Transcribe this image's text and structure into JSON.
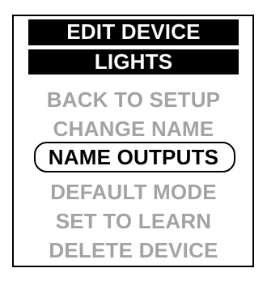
{
  "screen": {
    "title": "EDIT DEVICE",
    "device_name": "LIGHTS",
    "selected_index": 2,
    "menu_items": [
      {
        "label": "BACK TO SETUP"
      },
      {
        "label": "CHANGE NAME"
      },
      {
        "label": "NAME OUTPUTS"
      },
      {
        "label": "DEFAULT MODE"
      },
      {
        "label": "SET TO LEARN"
      },
      {
        "label": "DELETE DEVICE"
      }
    ]
  },
  "colors": {
    "background": "#ffffff",
    "bar": "#000000",
    "bar_text": "#ffffff",
    "inactive_text": "#a3a3a3",
    "selected_text": "#000000"
  }
}
